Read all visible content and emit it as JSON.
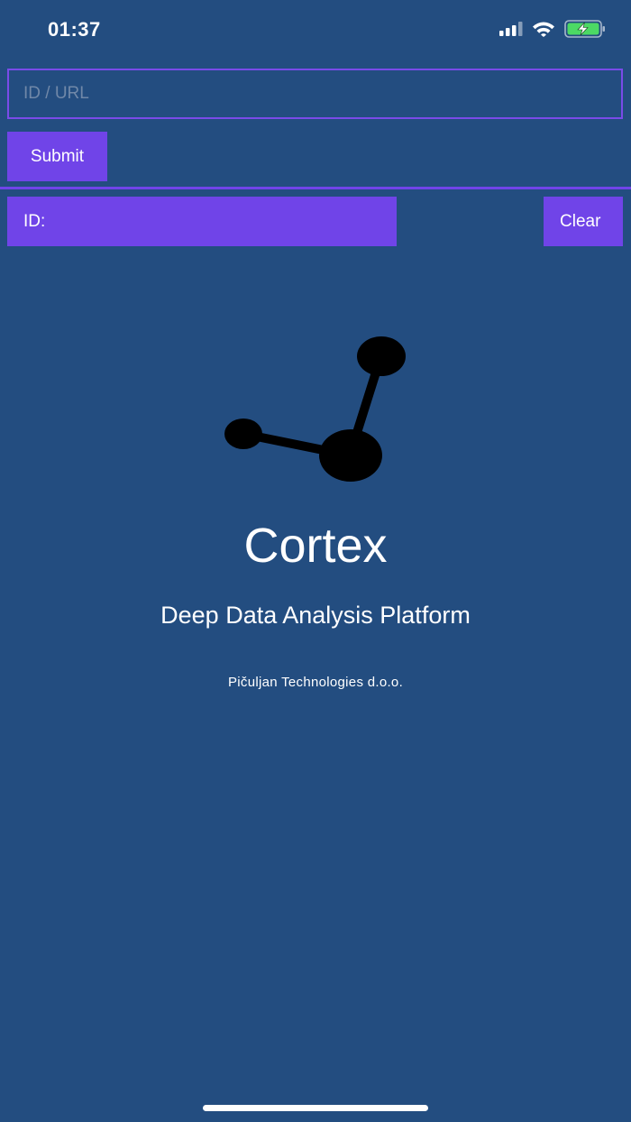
{
  "status_bar": {
    "time": "01:37",
    "icons": [
      "signal-icon",
      "wifi-icon",
      "battery-charging-icon"
    ]
  },
  "search": {
    "placeholder": "ID / URL",
    "value": ""
  },
  "submit_label": "Submit",
  "id_label": "ID:",
  "clear_label": "Clear",
  "brand": {
    "logo_icon": "molecule-logo-icon",
    "title": "Cortex",
    "subtitle": "Deep Data Analysis Platform",
    "company": "Pičuljan Technologies d.o.o."
  },
  "colors": {
    "background": "#234d80",
    "accent": "#7044e8",
    "text": "#ffffff",
    "logo": "#000000",
    "battery": "#4cd964"
  }
}
